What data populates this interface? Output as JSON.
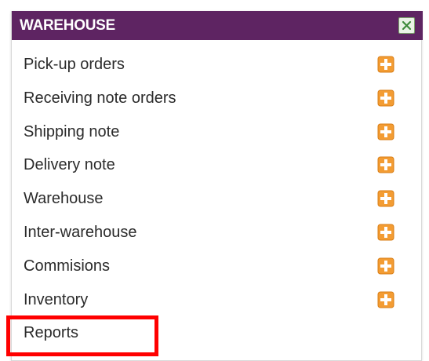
{
  "panel": {
    "title": "WAREHOUSE",
    "close_icon": "close-x-icon",
    "add_icon": "orange-plus-icon"
  },
  "menu": {
    "items": [
      {
        "label": "Pick-up orders",
        "has_add": true
      },
      {
        "label": "Receiving note orders",
        "has_add": true
      },
      {
        "label": "Shipping note",
        "has_add": true
      },
      {
        "label": "Delivery note",
        "has_add": true
      },
      {
        "label": "Warehouse",
        "has_add": true
      },
      {
        "label": "Inter-warehouse",
        "has_add": true
      },
      {
        "label": "Commisions",
        "has_add": true
      },
      {
        "label": "Inventory",
        "has_add": true
      },
      {
        "label": "Reports",
        "has_add": false
      }
    ]
  },
  "colors": {
    "header_bg": "#5e2462",
    "highlight": "#ff0000",
    "add_icon": "#f39c33"
  }
}
